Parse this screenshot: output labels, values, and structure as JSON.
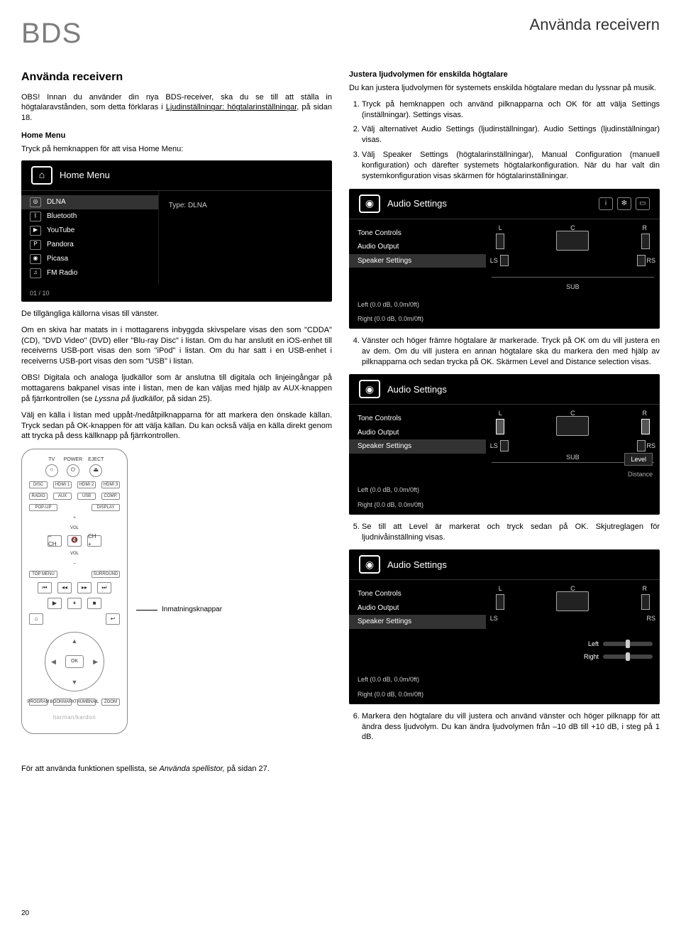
{
  "header": {
    "logo": "BDS",
    "page_title_right": "Använda receivern"
  },
  "left": {
    "heading": "Använda receivern",
    "intro": "OBS! Innan du använder din nya BDS-receiver, ska du se till att ställa in högtalaravstånden, som detta förklaras i ",
    "intro_link": "Ljudinställningar: högtalarinställningar",
    "intro_after": ", på sidan 18.",
    "home_menu_title": "Home Menu",
    "home_menu_desc": "Tryck på hemknappen för att visa Home Menu:",
    "home_menu_panel": {
      "title": "Home Menu",
      "items": [
        "DLNA",
        "Bluetooth",
        "YouTube",
        "Pandora",
        "Picasa",
        "FM Radio"
      ],
      "right_label": "Type: DLNA",
      "footer": "01 / 10"
    },
    "para_sources": "De tillgängliga källorna visas till vänster.",
    "para_disc": "Om en skiva har matats in i mottagarens inbyggda skivspelare visas den som \"CDDA\" (CD), \"DVD Video\" (DVD) eller \"Blu-ray Disc\" i listan. Om du har anslutit en iOS-enhet till receiverns USB-port visas den som \"iPod\" i listan. Om du har satt i en USB-enhet i receiverns USB-port visas den som \"USB\" i listan.",
    "para_obs": "OBS! Digitala och analoga ljudkällor som är anslutna till digitala och linjeingångar på mottagarens bakpanel visas inte i listan, men de kan väljas med hjälp av AUX-knappen på fjärrkontrollen (se ",
    "para_obs_link": "Lyssna på ljudkällor,",
    "para_obs_after": " på sidan 25).",
    "para_select": "Välj en källa i listan med uppåt-/nedåtpilknapparna för att markera den önskade källan. Tryck sedan på OK-knappen för att välja källan. Du kan också välja en källa direkt genom att trycka på dess källknapp på fjärrkontrollen.",
    "footer_playlist": "För att använda funktionen spellista, se ",
    "footer_playlist_link": "Använda spellistor,",
    "footer_playlist_after": " på sidan 27."
  },
  "remote": {
    "top_labels": [
      "TV",
      "POWER",
      "EJECT"
    ],
    "input_row1": [
      "DISC",
      "HDMI 1",
      "HDMI 2",
      "HDMI 3"
    ],
    "input_row2": [
      "RADIO",
      "AUX",
      "USB",
      "COMP."
    ],
    "popup": "POP-UP",
    "display": "DISPLAY",
    "vol_plus": "VOL +",
    "vol_minus": "VOL –",
    "ch_minus": "– CH",
    "ch_plus": "CH +",
    "top_menu": "TOP MENU",
    "surround": "SURROUND",
    "ok": "OK",
    "row_bottom": [
      "PROGRAM",
      "BOOKMARK",
      "THUMBNAIL",
      "ZOOM"
    ],
    "brand": "harman/kardon",
    "callout": "Inmatningsknappar"
  },
  "right": {
    "heading": "Justera ljudvolymen för enskilda högtalare",
    "intro": "Du kan justera ljudvolymen för systemets enskilda högtalare medan du lyssnar på musik.",
    "steps1": [
      "Tryck på hemknappen och använd pilknapparna och OK för att välja Settings (inställningar). Settings visas.",
      "Välj alternativet Audio Settings (ljudinställningar). Audio Settings (ljudinställningar) visas.",
      "Välj Speaker Settings (högtalarinställningar), Manual Configuration (manuell konfiguration) och därefter systemets högtalarkonfiguration. När du har valt din systemkonfiguration visas skärmen för högtalarinställningar."
    ],
    "audio_panel": {
      "title": "Audio Settings",
      "menu": [
        "Tone Controls",
        "Audio Output",
        "Speaker Settings"
      ],
      "spk_labels": {
        "L": "L",
        "C": "C",
        "R": "R",
        "LS": "LS",
        "RS": "RS",
        "SUB": "SUB"
      },
      "status1": "Left (0.0 dB, 0.0m/0ft)",
      "status2": "Right (0.0 dB, 0.0m/0ft)",
      "level": "Level",
      "distance": "Distance",
      "left_label": "Left",
      "right_label": "Right"
    },
    "step4": "Vänster och höger främre högtalare är markerade. Tryck på OK om du vill justera en av dem. Om du vill justera en annan högtalare ska du markera den med hjälp av pilknapparna och sedan trycka på OK. Skärmen Level and Distance selection visas.",
    "step5": "Se till att Level är markerat och tryck sedan på OK. Skjutreglagen för ljudnivåinställning visas.",
    "step6": "Markera den högtalare du vill justera och använd vänster och höger pilknapp för att ändra dess ljudvolym. Du kan ändra ljudvolymen från –10 dB till +10 dB, i steg på 1 dB."
  },
  "page_number": "20"
}
